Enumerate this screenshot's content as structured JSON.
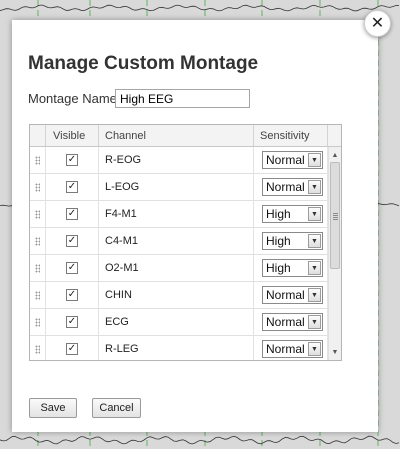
{
  "dialog": {
    "title": "Manage Custom Montage",
    "close_glyph": "✕",
    "montage_name_label": "Montage Name:",
    "montage_name_value": "High EEG"
  },
  "table": {
    "headers": {
      "visible": "Visible",
      "channel": "Channel",
      "sensitivity": "Sensitivity"
    },
    "rows": [
      {
        "visible": true,
        "channel": "R-EOG",
        "sensitivity": "Normal"
      },
      {
        "visible": true,
        "channel": "L-EOG",
        "sensitivity": "Normal"
      },
      {
        "visible": true,
        "channel": "F4-M1",
        "sensitivity": "High"
      },
      {
        "visible": true,
        "channel": "C4-M1",
        "sensitivity": "High"
      },
      {
        "visible": true,
        "channel": "O2-M1",
        "sensitivity": "High"
      },
      {
        "visible": true,
        "channel": "CHIN",
        "sensitivity": "Normal"
      },
      {
        "visible": true,
        "channel": "ECG",
        "sensitivity": "Normal"
      },
      {
        "visible": true,
        "channel": "R-LEG",
        "sensitivity": "Normal"
      }
    ],
    "check_glyph": "✓",
    "dropdown_glyph": "▼",
    "scroll_up_glyph": "▲",
    "scroll_down_glyph": "▼"
  },
  "buttons": {
    "save": "Save",
    "cancel": "Cancel"
  },
  "colors": {
    "background": "#d9d9d9",
    "grid_line": "#44aa44",
    "trace": "#333333",
    "dialog": "#ffffff",
    "title": "#333333"
  }
}
